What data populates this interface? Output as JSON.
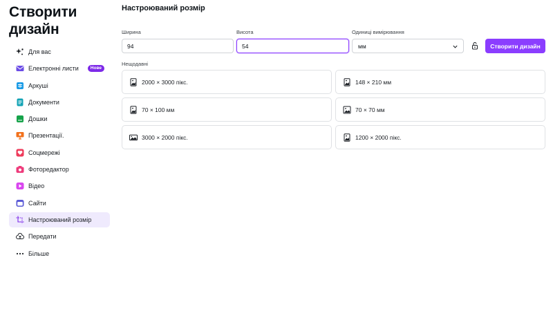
{
  "app_title_line1": "Створити",
  "app_title_line2": "дизайн",
  "sidebar": {
    "items": [
      {
        "label": "Для вас",
        "icon": "sparkle-icon",
        "color": "#1b1f24"
      },
      {
        "label": "Електронні листи",
        "icon": "email-icon",
        "color": "#6b4ce6",
        "badge": "Нове"
      },
      {
        "label": "Аркуші",
        "icon": "sheets-icon",
        "color": "#1a9be6"
      },
      {
        "label": "Документи",
        "icon": "docs-icon",
        "color": "#13a3b5"
      },
      {
        "label": "Дошки",
        "icon": "whiteboard-icon",
        "color": "#16a34a"
      },
      {
        "label": "Презентації.",
        "icon": "presentation-icon",
        "color": "#f2711c"
      },
      {
        "label": "Соцмережі",
        "icon": "heart-icon",
        "color": "#ee3b5b"
      },
      {
        "label": "Фоторедактор",
        "icon": "camera-icon",
        "color": "#ee3b7b"
      },
      {
        "label": "Відео",
        "icon": "video-icon",
        "color": "#d946ef"
      },
      {
        "label": "Сайти",
        "icon": "website-icon",
        "color": "#5b5bd6"
      },
      {
        "label": "Настроюваний розмір",
        "icon": "custom-size-icon",
        "color": "#7d2ae8",
        "active": true
      },
      {
        "label": "Передати",
        "icon": "upload-cloud-icon",
        "color": "#1b1f24"
      },
      {
        "label": "Більше",
        "icon": "more-icon",
        "color": "#1b1f24"
      }
    ]
  },
  "main": {
    "title": "Настроюваний розмір",
    "width_label": "Ширина",
    "width_value": "94",
    "height_label": "Висота",
    "height_value": "54",
    "units_label": "Одиниці вимірювання",
    "units_value": "мм",
    "create_button": "Створити дизайн",
    "recent_label": "Нещодавні",
    "recent": [
      {
        "label": "2000 × 3000 пікс.",
        "icon": "portrait-image-icon"
      },
      {
        "label": "148 × 210 мм",
        "icon": "portrait-image-icon"
      },
      {
        "label": "70 × 100 мм",
        "icon": "portrait-image-icon"
      },
      {
        "label": "70 × 70 мм",
        "icon": "square-image-icon"
      },
      {
        "label": "3000 × 2000 пікс.",
        "icon": "landscape-image-icon"
      },
      {
        "label": "1200 × 2000 пікс.",
        "icon": "portrait-image-icon"
      }
    ]
  },
  "colors": {
    "accent": "#8b3dff",
    "active_bg": "#efeafd"
  }
}
